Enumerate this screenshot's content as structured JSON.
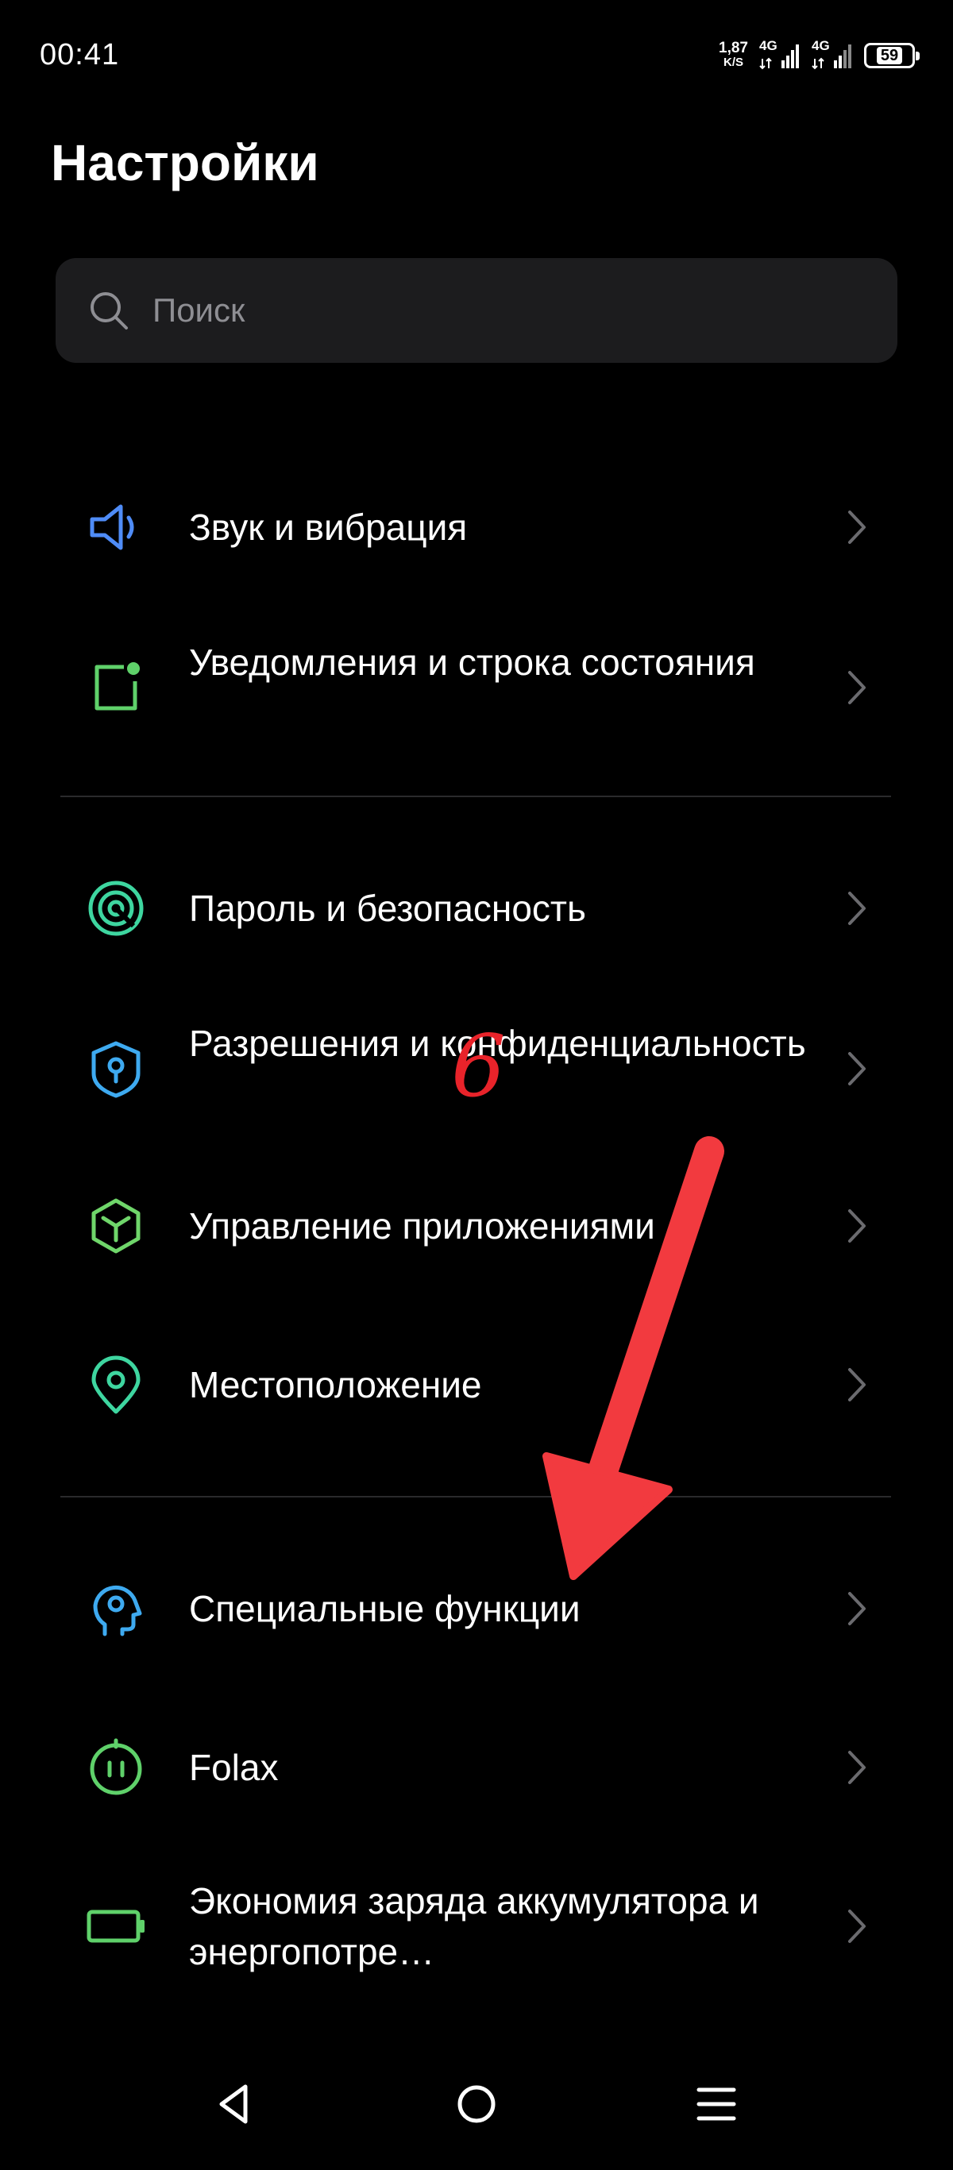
{
  "status_bar": {
    "time": "00:41",
    "net_speed_value": "1,87",
    "net_speed_unit": "K/S",
    "sim1_label": "4G",
    "sim2_label": "4G",
    "battery_level": "59"
  },
  "header": {
    "title": "Настройки"
  },
  "search": {
    "placeholder": "Поиск",
    "value": ""
  },
  "settings": {
    "items": [
      {
        "label": "Звук и вибрация",
        "icon": "speaker-icon",
        "color": "#4f8cf7"
      },
      {
        "label": "Уведомления и строка состояния",
        "icon": "notification-square-icon",
        "color": "#5fd16a"
      },
      {
        "label": "Пароль и безопасность",
        "icon": "fingerprint-target-icon",
        "color": "#3ed6a0"
      },
      {
        "label": "Разрешения и конфиденциальность",
        "icon": "shield-keyhole-icon",
        "color": "#3eaaf0"
      },
      {
        "label": "Управление приложениями",
        "icon": "cube-icon",
        "color": "#6fd66a"
      },
      {
        "label": "Местоположение",
        "icon": "location-pin-icon",
        "color": "#3ed6a0"
      },
      {
        "label": "Специальные функции",
        "icon": "head-accessibility-icon",
        "color": "#3eaaf0"
      },
      {
        "label": "Folax",
        "icon": "folax-assistant-icon",
        "color": "#5fd16a"
      },
      {
        "label": "Экономия заряда аккумулятора и энергопотре…",
        "icon": "battery-icon",
        "color": "#5fd16a"
      }
    ]
  },
  "annotation": {
    "number": "6",
    "color": "#e8232a"
  },
  "nav": {
    "back": "back-icon",
    "home": "home-icon",
    "menu": "menu-icon"
  },
  "colors": {
    "background": "#000000",
    "search_bg": "#1c1c1e",
    "divider": "#2a2a2c",
    "chevron": "#6b6b6f"
  }
}
